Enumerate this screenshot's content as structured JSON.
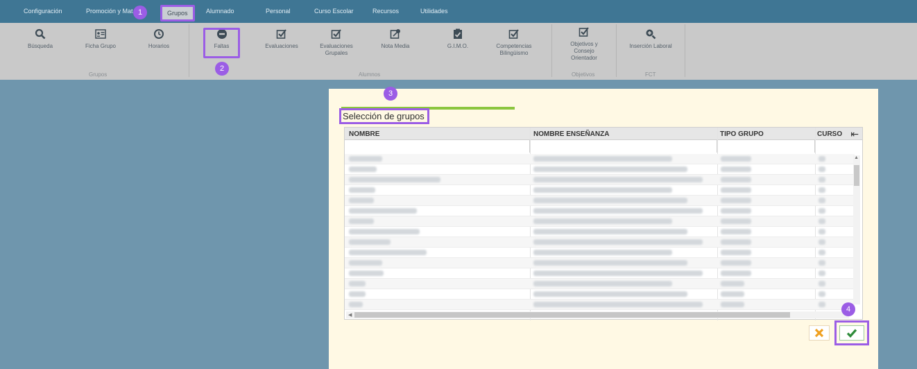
{
  "menu": [
    {
      "label": "Configuración"
    },
    {
      "label": "Promoción y Mat"
    },
    {
      "label": "Grupos",
      "active": true
    },
    {
      "label": "Alumnado"
    },
    {
      "label": "Personal"
    },
    {
      "label": "Curso Escolar"
    },
    {
      "label": "Recursos"
    },
    {
      "label": "Utilidades"
    }
  ],
  "ribbon": {
    "buttons": [
      {
        "label": "Búsqueda",
        "icon": "search-icon"
      },
      {
        "label": "Ficha Grupo",
        "icon": "id-card-icon"
      },
      {
        "label": "Horarios",
        "icon": "clock-icon"
      },
      {
        "label": "Faltas",
        "icon": "minus-circle-icon"
      },
      {
        "label": "Evaluaciones",
        "icon": "checkbox-icon"
      },
      {
        "label": "Evaluaciones",
        "label2": "Grupales",
        "icon": "checkbox-icon"
      },
      {
        "label": "Nota Media",
        "icon": "edit-note-icon"
      },
      {
        "label": "G.I.M.O.",
        "icon": "clipboard-check-icon"
      },
      {
        "label": "Competencias",
        "label2": "Bilingüismo",
        "icon": "checkbox-icon"
      },
      {
        "label": "Objetivos y",
        "label2": "Consejo",
        "label3": "Orientador",
        "icon": "checkbox-icon"
      },
      {
        "label": "Inserción Laboral",
        "icon": "zoom-icon"
      }
    ],
    "groups": [
      "Grupos",
      "Alumnos",
      "Objetivos",
      "FCT"
    ]
  },
  "badges": [
    "1",
    "2",
    "3",
    "4"
  ],
  "dialog": {
    "title": "Selección de grupos",
    "columns": [
      "NOMBRE",
      "NOMBRE ENSEÑANZA",
      "TIPO GRUPO",
      "CURSO"
    ]
  },
  "colors": {
    "menubar": "#3f7694",
    "ribbon": "#c9c9c9",
    "background": "#6f96ad",
    "dialog": "#fff9e4",
    "highlight": "#9b5de5",
    "accent_bar": "#8cc63f",
    "cancel": "#f0a020",
    "ok": "#2e8b3a"
  }
}
